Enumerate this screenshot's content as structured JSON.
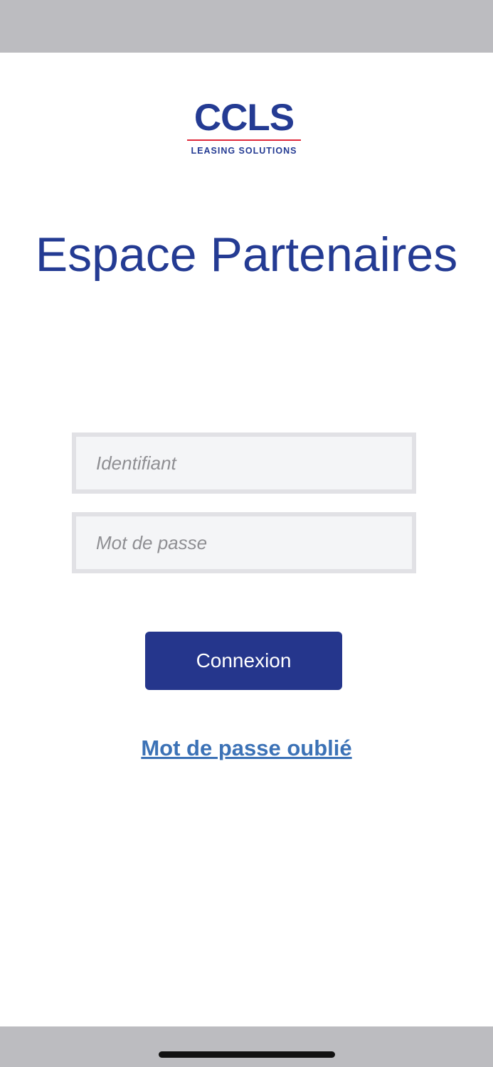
{
  "brand": {
    "logo_text": "CCLS",
    "logo_tagline": "LEASING SOLUTIONS",
    "primary_color": "#243b93",
    "accent_color": "#e0293a"
  },
  "page": {
    "title": "Espace Partenaires"
  },
  "form": {
    "username": {
      "value": "",
      "placeholder": "Identifiant"
    },
    "password": {
      "value": "",
      "placeholder": "Mot de passe"
    },
    "submit_label": "Connexion",
    "forgot_password_label": "Mot de passe oublié",
    "button_color": "#25368c",
    "link_color": "#3c72b6"
  }
}
